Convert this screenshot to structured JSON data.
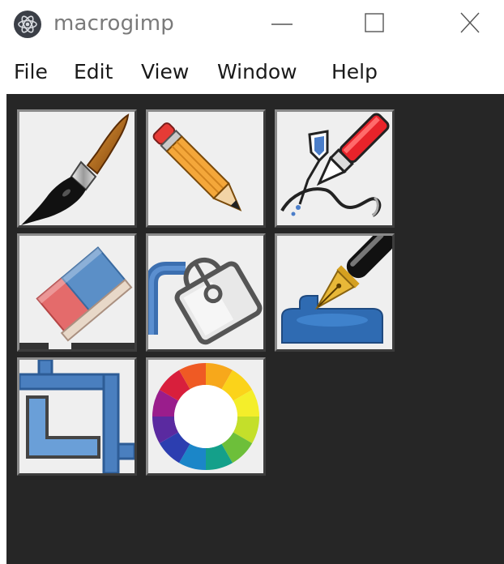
{
  "window": {
    "title": "macrogimp",
    "controls": [
      "minimize",
      "maximize",
      "close"
    ]
  },
  "menu": {
    "items": [
      {
        "label": "File"
      },
      {
        "label": "Edit"
      },
      {
        "label": "View"
      },
      {
        "label": "Window"
      },
      {
        "label": "Help"
      }
    ]
  },
  "tools": [
    {
      "name": "paintbrush",
      "icon": "paintbrush-icon"
    },
    {
      "name": "pencil",
      "icon": "pencil-icon"
    },
    {
      "name": "ink-pen",
      "icon": "ink-pen-icon"
    },
    {
      "name": "eraser",
      "icon": "eraser-icon"
    },
    {
      "name": "bucket-fill",
      "icon": "bucket-fill-icon"
    },
    {
      "name": "fountain-pen",
      "icon": "fountain-pen-icon"
    },
    {
      "name": "crop",
      "icon": "crop-icon"
    },
    {
      "name": "color-wheel",
      "icon": "color-wheel-icon"
    }
  ],
  "colors": {
    "canvas_background": "#262626",
    "tool_background": "#efefef",
    "title_text": "#7a7a7a"
  }
}
